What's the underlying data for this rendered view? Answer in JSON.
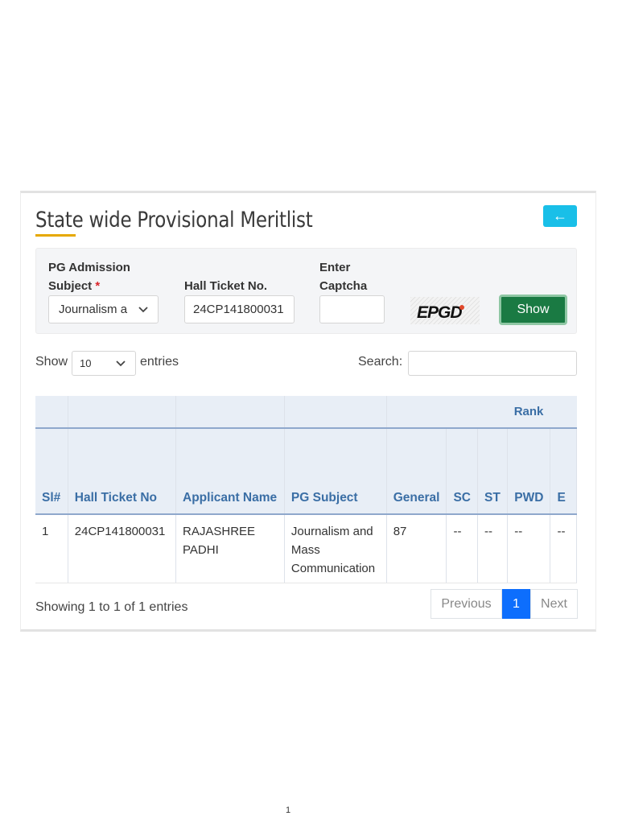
{
  "page": {
    "footer_number": "1"
  },
  "header": {
    "title": "State wide Provisional Meritlist",
    "back_button": "←"
  },
  "filters": {
    "subject_label": "PG Admission Subject",
    "subject_required": "*",
    "subject_value": "Journalism and Mass Communication",
    "hall_ticket_label": "Hall Ticket No.",
    "hall_ticket_value": "24CP141800031",
    "captcha_label": "Enter Captcha",
    "captcha_text": "EPGD",
    "show_button": "Show"
  },
  "table_controls": {
    "show_label": "Show",
    "page_length": "10",
    "entries_label": "entries",
    "search_label": "Search:"
  },
  "table": {
    "group_header": "Rank",
    "columns": [
      "Sl#",
      "Hall Ticket No",
      "Applicant Name",
      "PG Subject",
      "General",
      "SC",
      "ST",
      "PWD",
      "E"
    ],
    "rows": [
      [
        "1",
        "24CP141800031",
        "RAJASHREE PADHI",
        "Journalism and Mass Communication",
        "87",
        "--",
        "--",
        "--",
        "--"
      ]
    ]
  },
  "pagination": {
    "info": "Showing 1 to 1 of 1 entries",
    "previous": "Previous",
    "current": "1",
    "next": "Next"
  },
  "colors": {
    "accent": "#19bfe8",
    "show_button": "#1a7a43",
    "header_text": "#3a6ea5",
    "underline": "#e6a800",
    "active_page": "#0d6efd"
  },
  "icons": {
    "back": "arrow-left-icon",
    "dropdown": "chevron-down-icon",
    "captcha": "captcha-image"
  }
}
